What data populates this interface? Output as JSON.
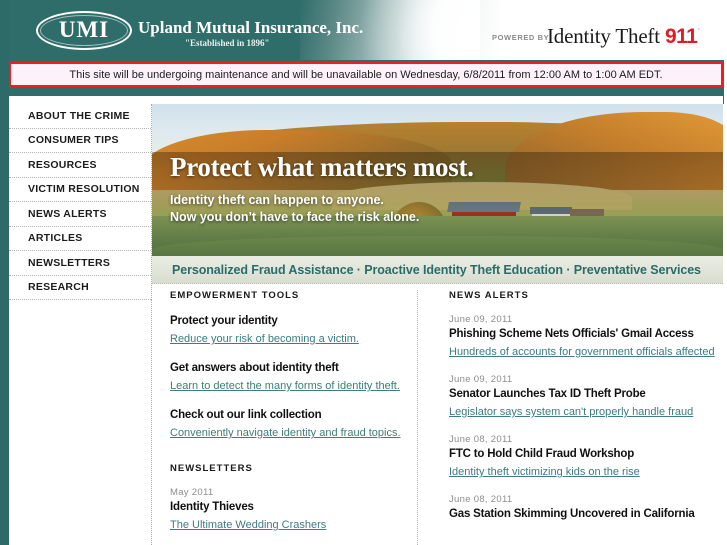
{
  "header": {
    "logo_initials": "UMI",
    "company_name": "Upland Mutual Insurance, Inc.",
    "company_tagline": "\"Established in 1896\"",
    "powered_by_label": "POWERED BY",
    "brand_name": "Identity Theft",
    "brand_number": "911",
    "brand_tm": "˙"
  },
  "maintenance": {
    "message": "This site will be undergoing maintenance and will be unavailable on Wednesday, 6/8/2011 from 12:00 AM to 1:00 AM EDT."
  },
  "sidebar": {
    "items": [
      {
        "label": "ABOUT THE CRIME"
      },
      {
        "label": "CONSUMER TIPS"
      },
      {
        "label": "RESOURCES"
      },
      {
        "label": "VICTIM RESOLUTION"
      },
      {
        "label": "NEWS ALERTS"
      },
      {
        "label": "ARTICLES"
      },
      {
        "label": "NEWSLETTERS"
      },
      {
        "label": "RESEARCH"
      }
    ]
  },
  "hero": {
    "headline": "Protect what matters most.",
    "sub_line_1": "Identity theft can happen to anyone.",
    "sub_line_2": "Now you don’t have to face the risk alone."
  },
  "tagline": {
    "text": "Personalized Fraud Assistance · Proactive Identity Theft Education · Preventative Services"
  },
  "empowerment_tools": {
    "title": "EMPOWERMENT TOOLS",
    "entries": [
      {
        "heading": "Protect your identity",
        "link": "Reduce your risk of becoming a victim."
      },
      {
        "heading": "Get answers about identity theft",
        "link": "Learn to detect the many forms of identity theft."
      },
      {
        "heading": "Check out our link collection",
        "link": "Conveniently navigate identity and fraud topics."
      }
    ]
  },
  "newsletters": {
    "title": "NEWSLETTERS",
    "entries": [
      {
        "date": "May 2011",
        "heading": "Identity Thieves",
        "link": "The Ultimate Wedding Crashers"
      }
    ]
  },
  "news_alerts": {
    "title": "NEWS ALERTS",
    "entries": [
      {
        "date": "June 09, 2011",
        "heading": "Phishing Scheme Nets Officials' Gmail Access",
        "link": "Hundreds of accounts for government officials affected"
      },
      {
        "date": "June 09, 2011",
        "heading": "Senator Launches Tax ID Theft Probe",
        "link": "Legislator says system can't properly handle fraud"
      },
      {
        "date": "June 08, 2011",
        "heading": "FTC to Hold Child Fraud Workshop",
        "link": "Identity theft victimizing kids on the rise"
      },
      {
        "date": "June 08, 2011",
        "heading": "Gas Station Skimming Uncovered in California",
        "link": ""
      }
    ]
  },
  "colors": {
    "brand_teal": "#2f6d6a",
    "link_teal": "#3f7b80",
    "alert_red": "#f01f1f",
    "brand_red": "#e01b22",
    "banner_bg": "#fdf2fb"
  }
}
